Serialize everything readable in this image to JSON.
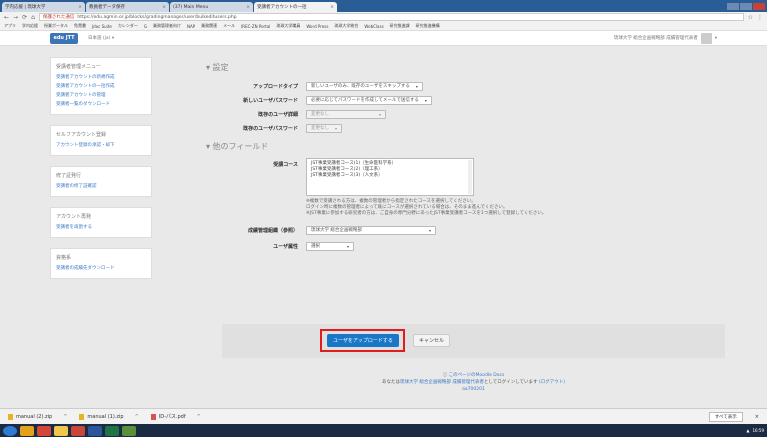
{
  "browser": {
    "tabs": [
      {
        "label": "学内応援 | 琉球大学",
        "active": false
      },
      {
        "label": "教員者データ保存",
        "active": false
      },
      {
        "label": "(37) Main Menu",
        "active": false
      },
      {
        "label": "受講者アカウントの一括",
        "active": true
      }
    ],
    "address": {
      "secure_label": "保護された通信",
      "url": "https://edu.agmin.or.jp/blocks/gradingmanager/user/bulkeditusers.php"
    },
    "bookmarks": [
      "アプリ",
      "学内応援",
      "授業ポータル",
      "免責書",
      "Jdoc Suite",
      "カレンダー",
      "G",
      "業務管理者向け",
      "NAP",
      "業務関連",
      "メール",
      "IREC-ZN Portal",
      "琉球大学職員",
      "Word Press",
      "琉球大学総合",
      "WebClass",
      "研究推進課",
      "研究推進機構"
    ]
  },
  "app": {
    "logo": "edu JTT",
    "language": "日本語 (ja) ▾",
    "user": "琉球大学 総合企画戦略部 成績管理代表者"
  },
  "sidebar": [
    {
      "title": "受講者管理メニュー",
      "links": [
        "受講者アカウントの新規作成",
        "受講者アカウントの一括作成",
        "受講者アカウントの管理",
        "受講者一覧のダウンロード"
      ]
    },
    {
      "title": "セルフアカウント登録",
      "links": [
        "アカウント登録の承認・却下"
      ]
    },
    {
      "title": "修了証発行",
      "links": [
        "受講者の修了証確認"
      ]
    },
    {
      "title": "アカウント再発",
      "links": [
        "受講者を再割する"
      ]
    },
    {
      "title": "資格系",
      "links": [
        "受講者の成績先ダウンロード"
      ]
    }
  ],
  "settings": {
    "section_label": "▾ 設定",
    "upload_type": {
      "label": "アップロードタイプ",
      "value": "新しいユーザのみ、既存のユーザをスキップする"
    },
    "new_password": {
      "label": "新しいユーザパスワード",
      "value": "必要に応じてパスワードを作成してメールで送信する"
    },
    "existing_details": {
      "label": "既存のユーザ詳細",
      "value": "変更なし"
    },
    "existing_password": {
      "label": "既存のユーザパスワード",
      "value": "変更なし"
    }
  },
  "other_fields": {
    "section_label": "▾ 他のフィールド",
    "course": {
      "label": "受講コース",
      "options": [
        "JST事業受講者コース(1)（生命医科学系）",
        "JST事業受講者コース(2)（理工系）",
        "JST事業受講者コース(3)（人文系）"
      ]
    },
    "notes": [
      "※複数で受講される方は、複数の管理者から指定されたコースを選択してください。",
      "ログイン時に複数の管理者によって既にコースが選択されている場合は、そのまま進んでください。",
      "※JST事業に参加する研究者の方は、ご自身の専門分野にあったJST事業受講者コースを1つ選択して登録してください。"
    ],
    "org": {
      "label": "成績管理組織（参照）",
      "value": "琉球大学 総合企画戦略部"
    },
    "attribute": {
      "label": "ユーザ属性",
      "value": "選択"
    }
  },
  "actions": {
    "upload": "ユーザをアップロードする",
    "cancel": "キャンセル"
  },
  "footer": {
    "docs": "このページのMoodle Docs",
    "login_prefix": "あなたは",
    "login_user": "琉球大学 総合企画戦略部 成績管理代表者",
    "login_suffix": "としてログインしています",
    "logout": "(ログアウト)",
    "code": "aa700201"
  },
  "downloads": {
    "items": [
      {
        "name": "manual (2).zip",
        "type": "zip"
      },
      {
        "name": "manual (1).zip",
        "type": "zip"
      },
      {
        "name": "ID-パス.pdf",
        "type": "pdf"
      }
    ],
    "show_all": "すべて表示"
  },
  "taskbar": {
    "clock": "16:59"
  }
}
